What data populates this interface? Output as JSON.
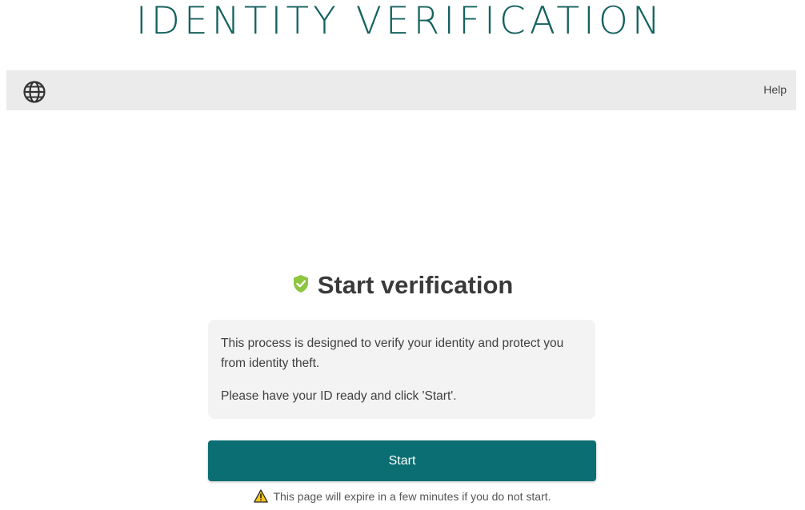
{
  "header": {
    "logo_text": "IDENTITY VERIFICATION"
  },
  "toolbar": {
    "language_icon": "globe-icon",
    "help_label": "Help"
  },
  "main": {
    "title_icon": "shield-check-icon",
    "title": "Start verification",
    "paragraph_1": "This process is designed to verify your identity and protect you from identity theft.",
    "paragraph_2": "Please have your ID ready and click 'Start'.",
    "start_label": "Start",
    "warning_icon": "warning-icon",
    "warning_text": "This page will expire in a few minutes if you do not start."
  },
  "colors": {
    "brand": "#14625f",
    "button": "#0b6e72",
    "shield": "#8dc63f",
    "toolbar_bg": "#ebebeb",
    "warning": "#f5c518"
  }
}
